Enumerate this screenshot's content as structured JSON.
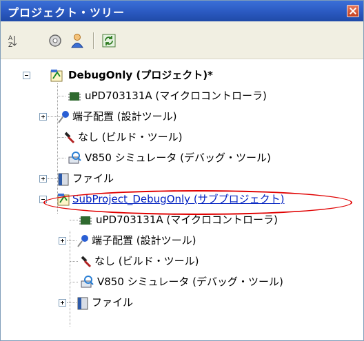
{
  "panel": {
    "title": "プロジェクト・ツリー"
  },
  "toolbar": {
    "items": [
      "sort-icon",
      "property-icon",
      "user-icon",
      "refresh-icon"
    ]
  },
  "tree": {
    "root": {
      "label": "DebugOnly (プロジェクト)*"
    },
    "main": [
      {
        "label": "uPD703131A (マイクロコントローラ)"
      },
      {
        "label": "端子配置 (設計ツール)"
      },
      {
        "label": "なし (ビルド・ツール)"
      },
      {
        "label": "V850 シミュレータ (デバッグ・ツール)"
      },
      {
        "label": "ファイル"
      }
    ],
    "subproject": {
      "label": "SubProject_DebugOnly (サブプロジェクト)"
    },
    "sub": [
      {
        "label": "uPD703131A (マイクロコントローラ)"
      },
      {
        "label": "端子配置 (設計ツール)"
      },
      {
        "label": "なし (ビルド・ツール)"
      },
      {
        "label": "V850 シミュレータ (デバッグ・ツール)"
      },
      {
        "label": "ファイル"
      }
    ]
  },
  "colors": {
    "title_bg": "#2c5bc3",
    "annotation": "#e00000",
    "selection_text": "#0020c0"
  }
}
